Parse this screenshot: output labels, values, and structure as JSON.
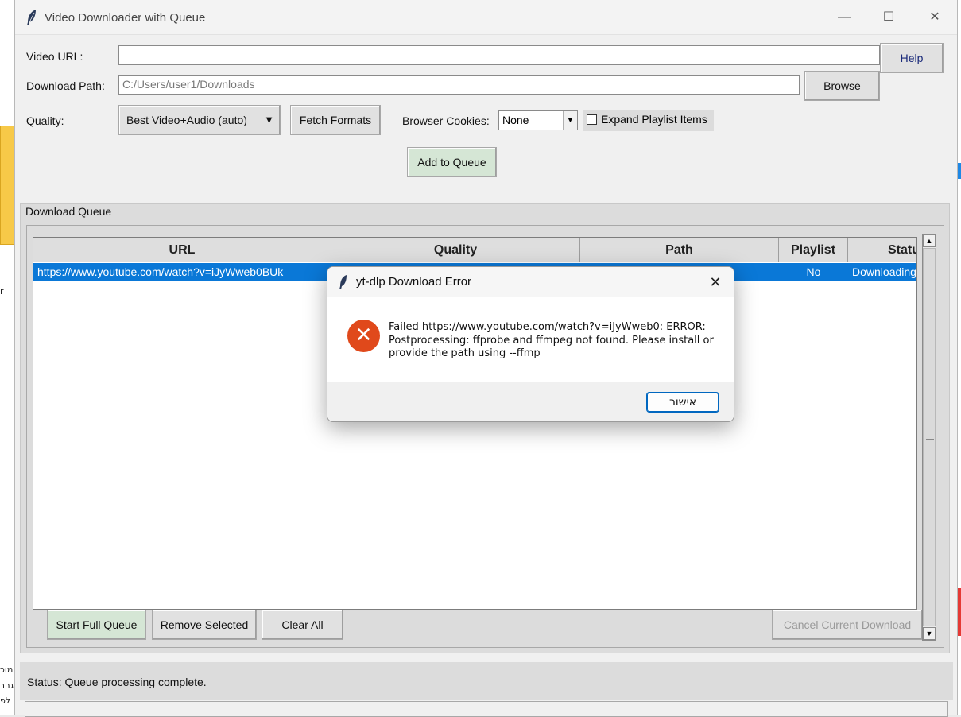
{
  "background": {
    "left_fragments": [
      "r",
      "מוכ",
      "גרב",
      "לפ ·"
    ]
  },
  "window": {
    "title": "Video Downloader with Queue",
    "controls": {
      "minimize": "—",
      "maximize": "☐",
      "close": "✕"
    }
  },
  "form": {
    "url_label": "Video URL:",
    "url_value": "",
    "help_button": "Help",
    "path_label": "Download Path:",
    "path_value": "C:/Users/user1/Downloads",
    "browse_button": "Browse",
    "quality_label": "Quality:",
    "quality_value": "Best Video+Audio (auto)",
    "fetch_formats_button": "Fetch Formats",
    "cookies_label": "Browser Cookies:",
    "cookies_value": "None",
    "expand_playlist_label": "Expand Playlist Items",
    "expand_playlist_checked": false,
    "add_to_queue_button": "Add to Queue"
  },
  "queue": {
    "frame_label": "Download Queue",
    "columns": [
      "URL",
      "Quality",
      "Path",
      "Playlist",
      "Status"
    ],
    "rows": [
      {
        "url": "https://www.youtube.com/watch?v=iJyWweb0BUk",
        "quality": "",
        "path": "",
        "playlist": "No",
        "status": "Downloading"
      }
    ],
    "selected_row": 0,
    "buttons": {
      "start_full_queue": "Start Full Queue",
      "remove_selected": "Remove Selected",
      "clear_all": "Clear All",
      "cancel_current": "Cancel Current Download"
    }
  },
  "status": {
    "text": "Status: Queue processing complete."
  },
  "dialog": {
    "title": "yt-dlp Download Error",
    "close": "✕",
    "icon": "error-icon",
    "message": "Failed https://www.youtube.com/watch?v=iJyWweb0: ERROR: Postprocessing: ffprobe and ffmpeg not found. Please install or provide the path using --ffmp",
    "ok_button": "אישור"
  },
  "colors": {
    "selection": "#0a78d7",
    "error": "#e0491b",
    "green_button": "#d5e6d5"
  }
}
